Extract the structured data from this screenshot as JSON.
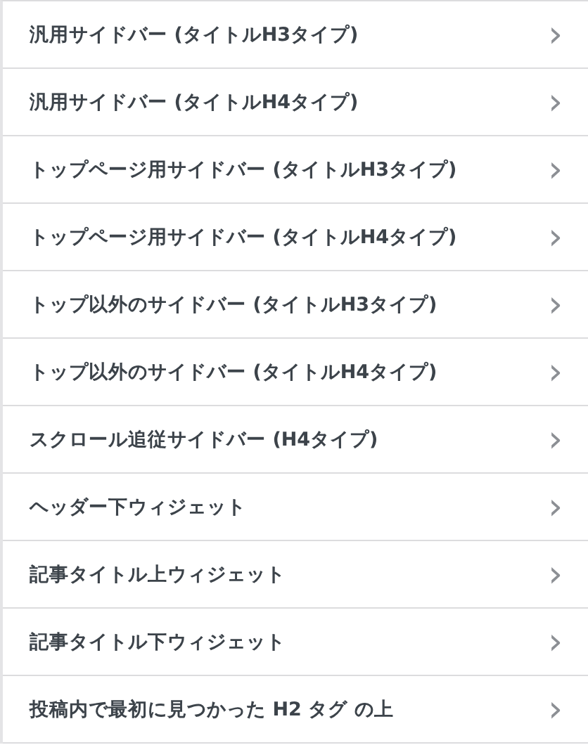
{
  "items": [
    {
      "label": "汎用サイドバー (タイトルH3タイプ)",
      "chevron": "›"
    },
    {
      "label": "汎用サイドバー (タイトルH4タイプ)",
      "chevron": "›"
    },
    {
      "label": "トップページ用サイドバー (タイトルH3タイプ)",
      "chevron": "›"
    },
    {
      "label": "トップページ用サイドバー (タイトルH4タイプ)",
      "chevron": "›"
    },
    {
      "label": "トップ以外のサイドバー (タイトルH3タイプ)",
      "chevron": "›"
    },
    {
      "label": "トップ以外のサイドバー (タイトルH4タイプ)",
      "chevron": "›"
    },
    {
      "label": "スクロール追従サイドバー (H4タイプ)",
      "chevron": "›"
    },
    {
      "label": "ヘッダー下ウィジェット",
      "chevron": "›"
    },
    {
      "label": "記事タイトル上ウィジェット",
      "chevron": "›"
    },
    {
      "label": "記事タイトル下ウィジェット",
      "chevron": "›"
    },
    {
      "label": "投稿内で最初に見つかった H2 タグ の上",
      "chevron": "›"
    }
  ]
}
